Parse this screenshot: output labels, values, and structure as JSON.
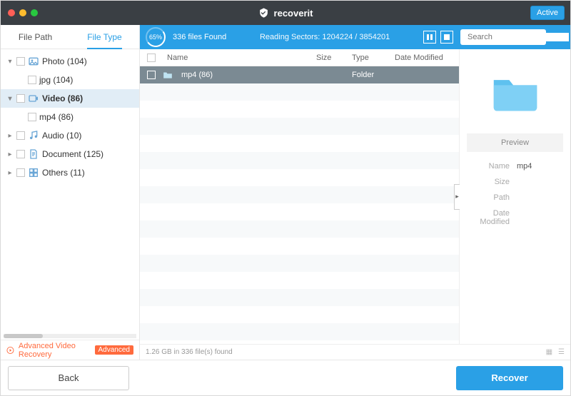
{
  "header": {
    "brand": "recoverit",
    "active_label": "Active"
  },
  "sidebar": {
    "tabs": {
      "path": "File Path",
      "type": "File Type"
    },
    "tree": [
      {
        "expander": "▾",
        "icon": "photo",
        "label": "Photo (104)",
        "children": [
          {
            "label": "jpg (104)"
          }
        ]
      },
      {
        "expander": "▾",
        "icon": "video",
        "label": "Video (86)",
        "selected": true,
        "children": [
          {
            "label": "mp4 (86)"
          }
        ]
      },
      {
        "expander": "▸",
        "icon": "audio",
        "label": "Audio (10)"
      },
      {
        "expander": "▸",
        "icon": "document",
        "label": "Document (125)"
      },
      {
        "expander": "▸",
        "icon": "others",
        "label": "Others (11)"
      }
    ],
    "adv": {
      "label": "Advanced Video Recovery",
      "badge": "Advanced"
    }
  },
  "toolbar": {
    "progress_pct": "65%",
    "found": "336 files Found",
    "sectors": "Reading Sectors: 1204224 / 3854201",
    "search_placeholder": "Search"
  },
  "list": {
    "headers": {
      "name": "Name",
      "size": "Size",
      "type": "Type",
      "modified": "Date Modified"
    },
    "rows": [
      {
        "name": "mp4 (86)",
        "size": "",
        "type": "Folder",
        "modified": ""
      }
    ]
  },
  "preview": {
    "button": "Preview",
    "meta": {
      "name_k": "Name",
      "name_v": "mp4",
      "size_k": "Size",
      "size_v": "",
      "path_k": "Path",
      "path_v": "",
      "mod_k": "Date Modified",
      "mod_v": ""
    }
  },
  "status": {
    "summary": "1.26 GB in 336 file(s) found"
  },
  "footer": {
    "back": "Back",
    "recover": "Recover"
  }
}
